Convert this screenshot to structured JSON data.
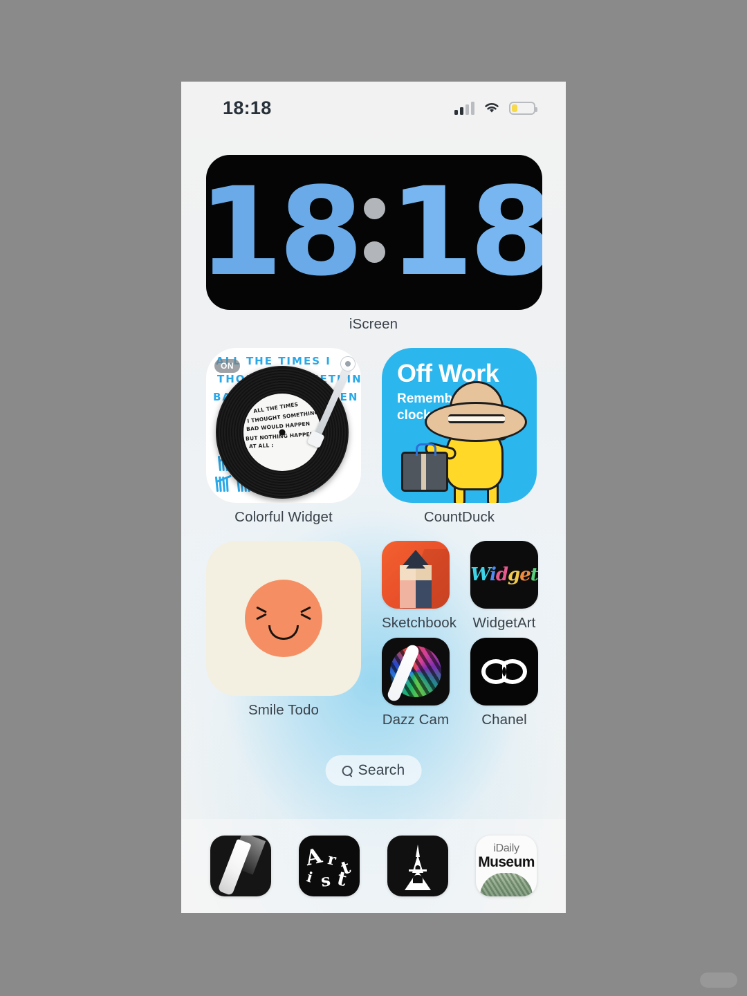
{
  "status_bar": {
    "time": "18:18",
    "cellular_icon": "cellular-signal-icon",
    "wifi_icon": "wifi-icon",
    "battery_icon": "battery-low-icon",
    "battery_color": "#f7d949"
  },
  "clock_widget": {
    "label": "iScreen",
    "hours": "18",
    "minutes": "18",
    "digit_color": "#6aaae8",
    "dot_color": "#b2b6ba",
    "background": "#050505"
  },
  "widgets": [
    {
      "name": "colorful-widget",
      "label": "Colorful Widget",
      "badge": "ON",
      "background": "#ffffff",
      "handwriting": [
        "ALL THE TIMES I",
        "THOUGHT SOMETHING",
        "BAD WOULD HAPPEN"
      ],
      "record_label_text": [
        "ALL THE TIMES",
        "I THOUGHT SOMETHING",
        "BAD WOULD HAPPEN",
        "BUT NOTHING HAPPENED",
        "AT ALL :"
      ],
      "ink_color": "#2aa8e8"
    },
    {
      "name": "countduck-widget",
      "label": "CountDuck",
      "title": "Off Work",
      "subtitle": "Remember to\nclock out",
      "background": "#2cb6ee",
      "character_color": "#ffd828"
    },
    {
      "name": "smile-todo-widget",
      "label": "Smile Todo",
      "background": "#f3f0e2",
      "face_color": "#f58f63"
    }
  ],
  "apps": [
    {
      "name": "sketchbook",
      "label": "Sketchbook",
      "icon": "pencil-icon",
      "background": "#e8502a"
    },
    {
      "name": "widgetart",
      "label": "WidgetArt",
      "icon": "widget-script-icon",
      "background": "#0c0c0c",
      "word": "Widget"
    },
    {
      "name": "dazz-cam",
      "label": "Dazz Cam",
      "icon": "color-swirl-icon",
      "background": "#0d0d0d"
    },
    {
      "name": "chanel",
      "label": "Chanel",
      "icon": "cc-logo-icon",
      "background": "#060606"
    }
  ],
  "search": {
    "label": "Search",
    "icon": "search-icon"
  },
  "dock": [
    {
      "name": "brush-app",
      "icon": "brush-stroke-icon",
      "background": "#151515"
    },
    {
      "name": "artist-app",
      "icon": "artist-letters-icon",
      "background": "#0b0b0b",
      "letters": [
        "A",
        "r",
        "t",
        "i",
        "s",
        "t"
      ]
    },
    {
      "name": "eiffel-app",
      "icon": "eiffel-tower-icon",
      "background": "#101010"
    },
    {
      "name": "idaily-museum-app",
      "icon": "museum-landscape-icon",
      "background": "#fbfbfb",
      "top_text": "iDaily",
      "bottom_text": "Museum"
    }
  ],
  "watermark": {
    "text": ""
  }
}
